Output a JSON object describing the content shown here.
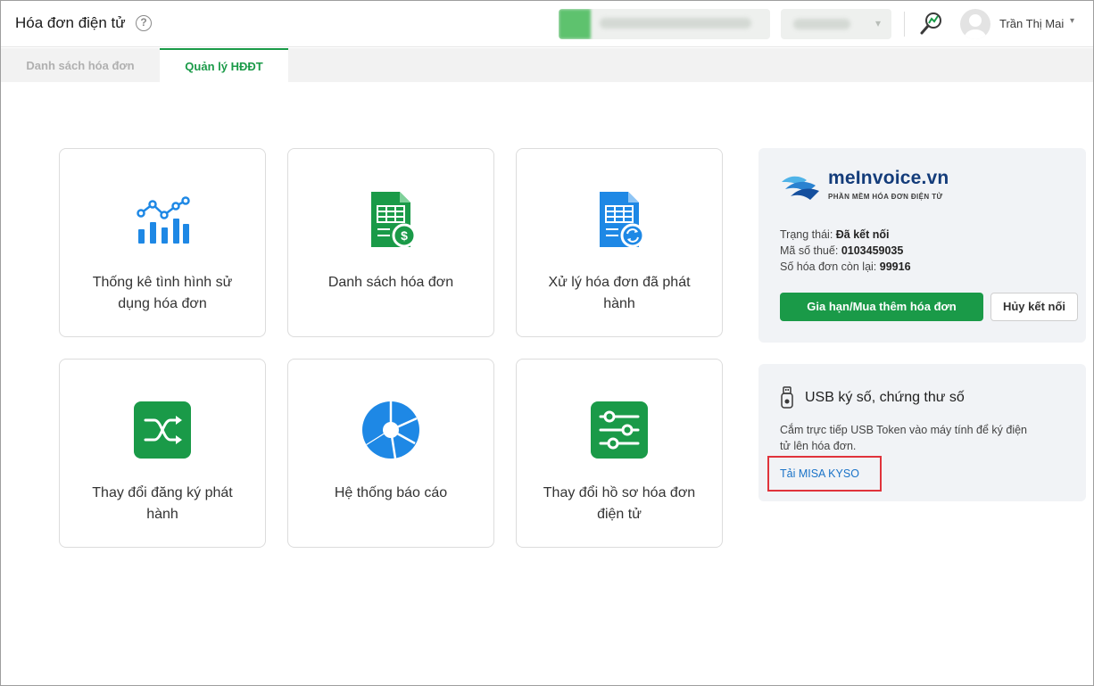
{
  "header": {
    "title": "Hóa đơn điện tử",
    "user_name": "Trần Thị Mai"
  },
  "tabs": [
    {
      "label": "Danh sách hóa đơn",
      "active": false
    },
    {
      "label": "Quản lý HĐĐT",
      "active": true
    }
  ],
  "cards": [
    {
      "label": "Thống kê tình hình sử dụng hóa đơn",
      "icon": "stats-chart-icon"
    },
    {
      "label": "Danh sách hóa đơn",
      "icon": "invoice-list-icon"
    },
    {
      "label": "Xử lý hóa đơn đã phát hành",
      "icon": "process-invoice-icon"
    },
    {
      "label": "Thay đổi đăng ký phát hành",
      "icon": "shuffle-icon"
    },
    {
      "label": "Hệ thống báo cáo",
      "icon": "pie-report-icon"
    },
    {
      "label": "Thay đổi hồ sơ hóa đơn điện tử",
      "icon": "settings-sliders-icon"
    }
  ],
  "meinvoice": {
    "brand_name": "meInvoice.vn",
    "brand_tagline": "PHẦN MỀM HÓA ĐƠN ĐIỆN TỬ",
    "status_label": "Trạng thái:",
    "status_value": "Đã kết nối",
    "tax_label": "Mã số thuế:",
    "tax_value": "0103459035",
    "remaining_label": "Số hóa đơn còn lại:",
    "remaining_value": "99916",
    "renew_button": "Gia hạn/Mua thêm hóa đơn",
    "disconnect_button": "Hủy kết nối"
  },
  "usb": {
    "title": "USB ký số, chứng thư số",
    "description": "Cắm trực tiếp USB Token vào máy tính để ký điện tử lên hóa đơn.",
    "link": "Tải MISA KYSO"
  },
  "colors": {
    "primary_green": "#1a9a48",
    "icon_blue": "#1e88e5",
    "highlight_red": "#e0333b",
    "link_blue": "#1a73c8"
  }
}
